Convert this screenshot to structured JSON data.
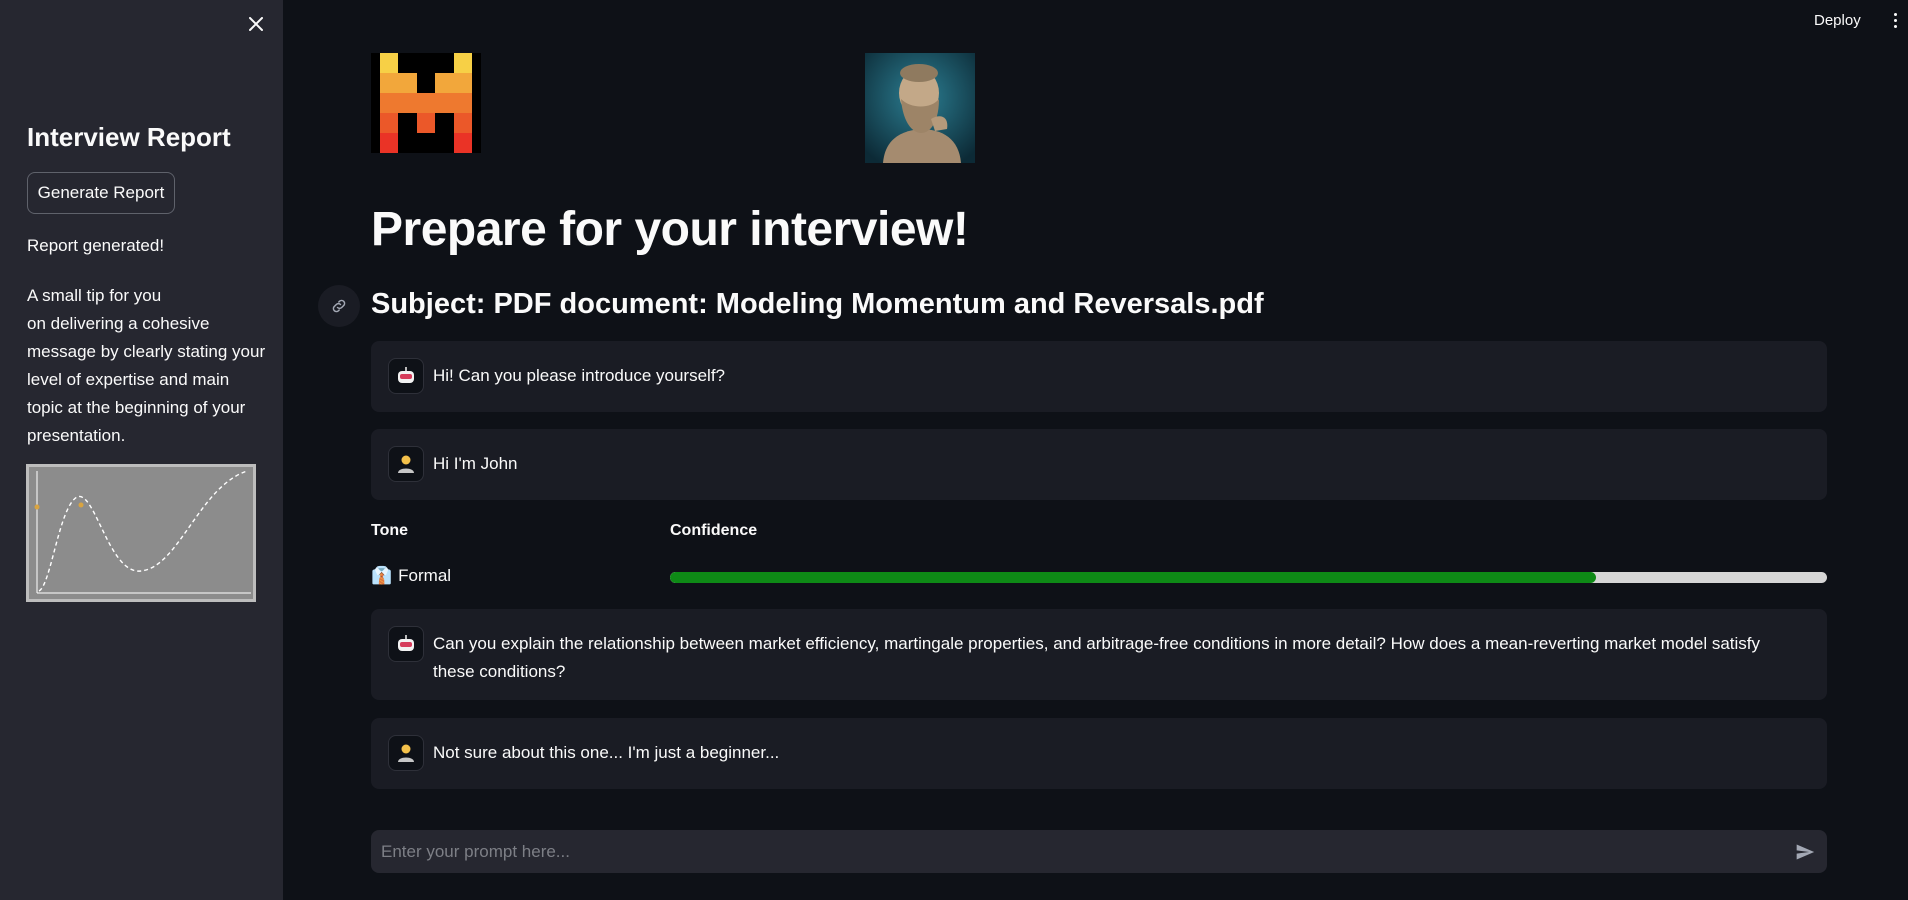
{
  "sidebar": {
    "title": "Interview Report",
    "generate_button": "Generate Report",
    "status": "Report generated!",
    "tip": "A small tip for you\non delivering a cohesive message by clearly stating your level of expertise and main topic at the beginning of your presentation."
  },
  "header": {
    "deploy_label": "Deploy"
  },
  "main": {
    "title": "Prepare for your interview!",
    "subject": "Subject: PDF document: Modeling Momentum and Reversals.pdf",
    "messages": [
      {
        "role": "assistant",
        "avatar": "robot-icon",
        "text": "Hi! Can you please introduce yourself?"
      },
      {
        "role": "user",
        "avatar": "user-icon",
        "text": "Hi I'm John"
      },
      {
        "role": "assistant",
        "avatar": "robot-icon",
        "text": "Can you explain the relationship between market efficiency, martingale properties, and arbitrage-free conditions in more detail? How does a mean-reverting market model satisfy these conditions?"
      },
      {
        "role": "user",
        "avatar": "user-icon",
        "text": "Not sure about this one... I'm just a beginner..."
      }
    ],
    "metrics": {
      "tone_header": "Tone",
      "confidence_header": "Confidence",
      "tone_emoji": "👔",
      "tone_value": "Formal",
      "confidence_fraction": 0.8
    }
  },
  "prompt": {
    "placeholder": "Enter your prompt here..."
  },
  "colors": {
    "background": "#0e1117",
    "sidebar": "#262730",
    "message_bg": "#1a1c24",
    "progress_fill": "#0e8a16",
    "progress_track": "#d6d6d6"
  }
}
